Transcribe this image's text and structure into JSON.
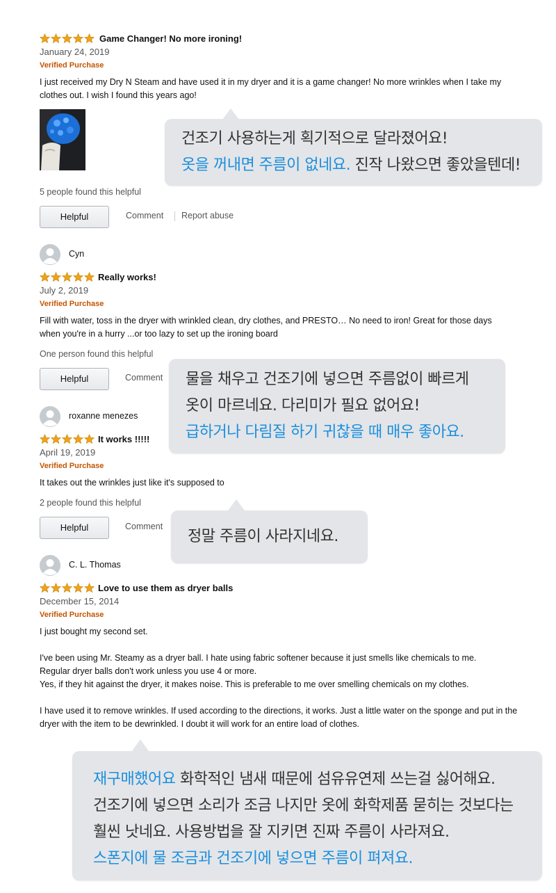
{
  "colors": {
    "star": "#f0a21a",
    "verified": "#c45500",
    "bubble": "#e4e5e8",
    "bubble_blue": "#1a8fde"
  },
  "reviews": [
    {
      "rating": 5,
      "title": "Game Changer! No more ironing!",
      "date": "January 24, 2019",
      "verified": "Verified Purchase",
      "body": "I just received my Dry N Steam and have used it in my dryer and it is a game changer! No more wrinkles when I take my clothes out. I wish I found this years ago!",
      "helpful_count": "5 people found this helpful",
      "helpful_button": "Helpful",
      "comment_link": "Comment",
      "report_link": "Report abuse"
    },
    {
      "username": "Cyn",
      "rating": 5,
      "title": "Really works!",
      "date": "July 2, 2019",
      "verified": "Verified Purchase",
      "body": "Fill with water, toss in the dryer with wrinkled clean, dry clothes, and PRESTO… No need to iron! Great for those days when you're in a hurry ...or too lazy to set up the ironing board",
      "helpful_count": "One person found this helpful",
      "helpful_button": "Helpful",
      "comment_link": "Comment"
    },
    {
      "username": "roxanne menezes",
      "rating": 5,
      "title": "It works !!!!!",
      "date": "April 19, 2019",
      "verified": "Verified Purchase",
      "body": "It takes out the wrinkles just like it's supposed to",
      "helpful_count": "2 people found this helpful",
      "helpful_button": "Helpful",
      "comment_link": "Comment"
    },
    {
      "username": "C. L. Thomas",
      "rating": 5,
      "title": "Love to use them as dryer balls",
      "date": "December 15, 2014",
      "verified": "Verified Purchase",
      "body_p1": "I just bought my second set.",
      "body_p2_l1": "I've been using Mr. Steamy as a dryer ball. I hate using fabric softener because it just smells like chemicals to me.",
      "body_p2_l2": "Regular dryer balls don't work unless you use 4 or more.",
      "body_p2_l3": "Yes, if they hit against the dryer, it makes noise. This is preferable to me over smelling chemicals on my clothes.",
      "body_p3": "I have used it to remove wrinkles. If used according to the directions, it works. Just a little water on the sponge and put in the dryer with the item to be dewrinkled. I doubt it will work for an entire load of clothes."
    }
  ],
  "bubbles": [
    {
      "line1": "건조기 사용하는게 획기적으로 달라졌어요!",
      "line2_blue": "옷을 꺼내면 주름이 없네요.",
      "line2_rest": " 진작 나왔으면 좋았을텐데!"
    },
    {
      "line1": "물을 채우고 건조기에 넣으면 주름없이 빠르게",
      "line2": "옷이 마르네요. 다리미가 필요 없어요!",
      "line3_blue": "급하거나 다림질 하기 귀찮을 때 매우 좋아요."
    },
    {
      "line1": "정말 주름이 사라지네요."
    },
    {
      "line1_blue": "재구매했어요",
      "line1_rest": " 화학적인 냄새 때문에 섬유유연제 쓰는걸 싫어해요.",
      "line2": "건조기에 넣으면 소리가 조금 나지만 옷에 화학제품 묻히는 것보다는",
      "line3": "훨씬 낫네요. 사용방법을 잘 지키면 진짜 주름이 사라져요.",
      "line4_blue": "스폰지에 물 조금과 건조기에 넣으면 주름이 펴져요."
    }
  ]
}
